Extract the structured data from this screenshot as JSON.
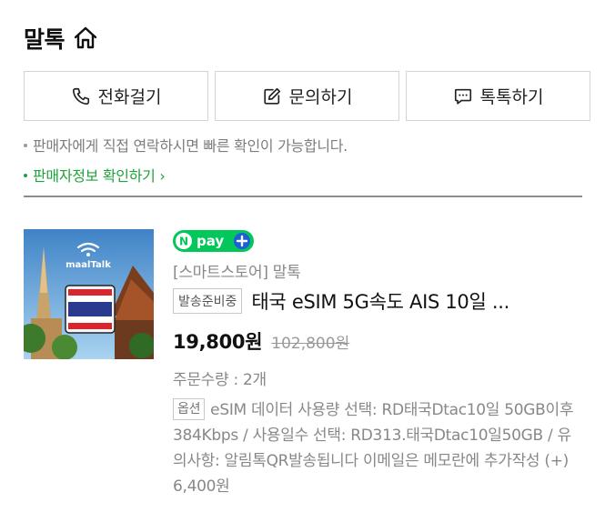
{
  "header": {
    "store_name": "말톡"
  },
  "contact_buttons": [
    {
      "label": "전화걸기",
      "icon": "phone-icon"
    },
    {
      "label": "문의하기",
      "icon": "edit-icon"
    },
    {
      "label": "톡톡하기",
      "icon": "chat-icon"
    }
  ],
  "notice": "판매자에게 직접 연락하시면 빠른 확인이 가능합니다.",
  "seller_link": "판매자정보 확인하기",
  "product": {
    "brand_text": "maalTalk",
    "badge": "npay+",
    "store_label": "[스마트스토어] 말톡",
    "status": "발송준비중",
    "title": "태국 eSIM 5G속도 AIS 10일 ...",
    "price": "19,800원",
    "original_price": "102,800원",
    "quantity": "주문수량 : 2개",
    "option_label": "옵션",
    "option_text": "eSIM 데이터 사용량 선택: RD태국Dtac10일 50GB이후 384Kbps / 사용일수 선택: RD313.태국Dtac10일50GB / 유의사항: 알림톡QR발송됩니다 이메일은 메모란에 추가작성 (+) 6,400원"
  },
  "colors": {
    "accent_green": "#1fa33b",
    "npay_green": "#03c75a",
    "muted_text": "#888888"
  }
}
